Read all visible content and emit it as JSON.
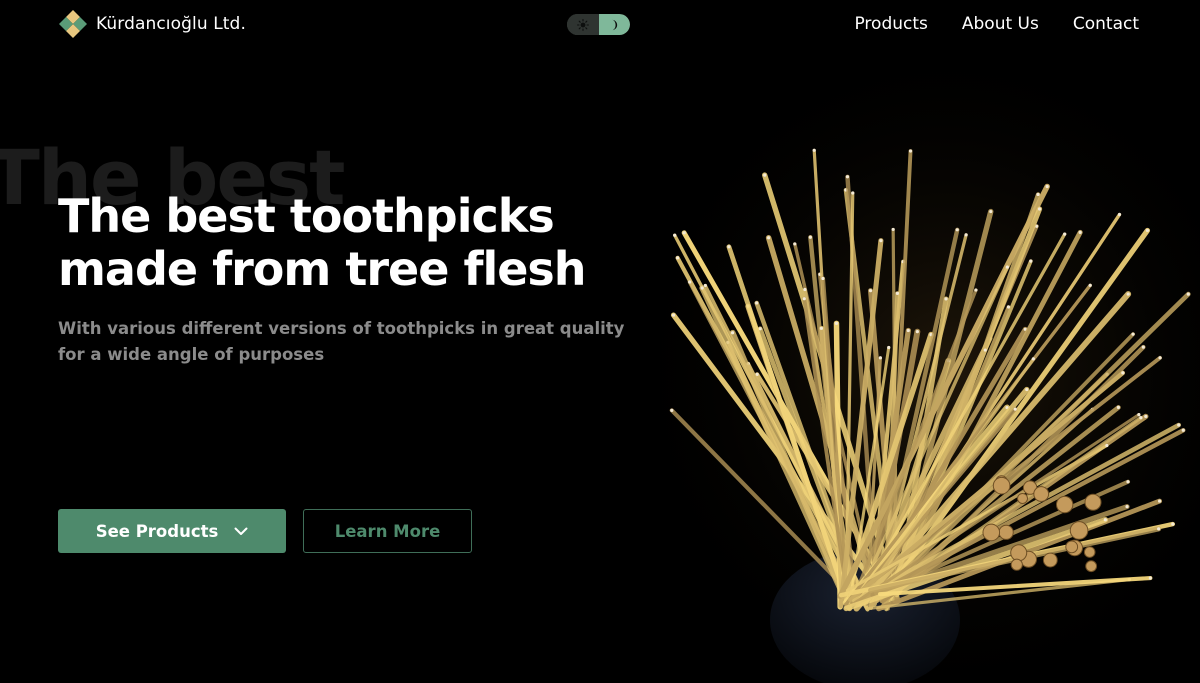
{
  "brand": {
    "name": "Kürdancıoğlu Ltd.",
    "logo_icon": "diamond-quad-logo-icon",
    "colors": {
      "logo_light": "#e8c77f",
      "logo_green": "#5a9c78"
    }
  },
  "theme_toggle": {
    "light_icon": "sun-icon",
    "dark_icon": "moon-icon",
    "active": "dark",
    "colors": {
      "track": "#2f3431",
      "active": "#7fb89a"
    }
  },
  "nav": {
    "items": [
      {
        "label": "Products"
      },
      {
        "label": "About Us"
      },
      {
        "label": "Contact"
      }
    ]
  },
  "hero": {
    "ghost_text": "The best",
    "title_line1": "The best toothpicks",
    "title_line2": "made from tree flesh",
    "subtitle": "With various different versions of toothpicks in great quality for a wide angle of purposes",
    "primary_button": {
      "label": "See Products",
      "icon": "chevron-down-icon"
    },
    "secondary_button": {
      "label": "Learn More"
    },
    "image_icon": "toothpick-bundle-photo",
    "colors": {
      "background": "#000000",
      "accent": "#4e8a6c",
      "subtitle": "#8b8b8b"
    }
  }
}
